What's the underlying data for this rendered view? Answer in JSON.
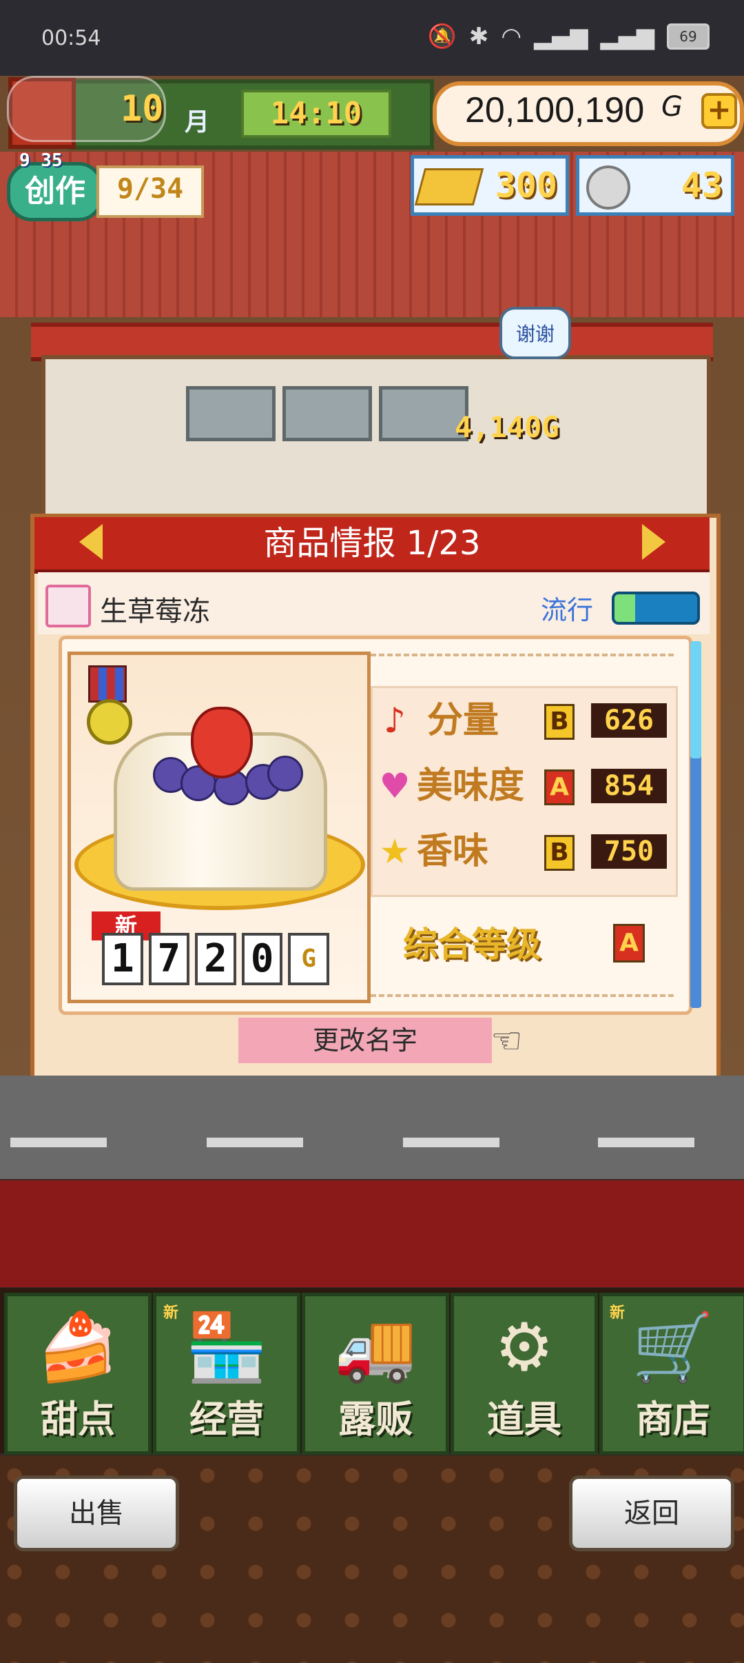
{
  "status_bar": {
    "time": "00:54",
    "battery": "69"
  },
  "top_bar": {
    "month_number": "10",
    "month_label": "月",
    "clock": "14:10",
    "money": "20,100,190",
    "money_unit": "G",
    "plus_symbol": "+"
  },
  "create": {
    "label": "创作",
    "sub": "9 35",
    "progress": "9/34"
  },
  "resources": {
    "gold_bar": "300",
    "coin": "43"
  },
  "shop": {
    "bubble": "谢谢",
    "sale_amount": "4,140G"
  },
  "product_panel": {
    "title": "商品情报",
    "page": "1/23",
    "product_name": "生草莓冻",
    "trend_label": "流行",
    "trend_level": 0.25,
    "new_tag": "新",
    "price_digits": [
      "1",
      "7",
      "2",
      "0"
    ],
    "price_unit": "G",
    "stats": [
      {
        "icon": "music-note-icon",
        "label": "分量",
        "grade": "B",
        "value": "626"
      },
      {
        "icon": "heart-icon",
        "label": "美味度",
        "grade": "A",
        "value": "854"
      },
      {
        "icon": "star-icon",
        "label": "香味",
        "grade": "B",
        "value": "750"
      }
    ],
    "overall_label": "综合等级",
    "overall_grade": "A",
    "rename_label": "更改名字"
  },
  "nav": [
    {
      "id": "desserts",
      "label": "甜点",
      "new": ""
    },
    {
      "id": "manage",
      "label": "经营",
      "new": "新"
    },
    {
      "id": "stall",
      "label": "露贩",
      "new": ""
    },
    {
      "id": "items",
      "label": "道具",
      "new": ""
    },
    {
      "id": "store",
      "label": "商店",
      "new": "新"
    }
  ],
  "bottom": {
    "sell_label": "出售",
    "back_label": "返回"
  },
  "colors": {
    "accent_red": "#c0261a",
    "grade_a": "#d83020",
    "gold": "#ffd34d"
  }
}
